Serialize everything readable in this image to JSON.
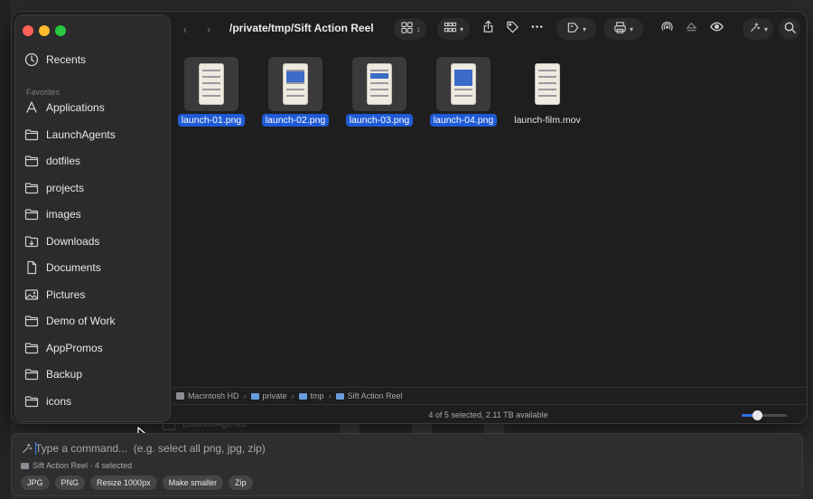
{
  "window": {
    "path_title": "/private/tmp/Sift Action Reel"
  },
  "sidebar": {
    "top_items": [
      {
        "label": "Recents",
        "icon": "clock-icon"
      }
    ],
    "section_label": "Favorites",
    "items": [
      {
        "label": "Applications",
        "icon": "applications-icon"
      },
      {
        "label": "LaunchAgents",
        "icon": "folder-icon"
      },
      {
        "label": "dotfiles",
        "icon": "folder-icon"
      },
      {
        "label": "projects",
        "icon": "folder-icon"
      },
      {
        "label": "images",
        "icon": "folder-icon"
      },
      {
        "label": "Downloads",
        "icon": "download-icon"
      },
      {
        "label": "Documents",
        "icon": "document-icon"
      },
      {
        "label": "Pictures",
        "icon": "picture-icon"
      },
      {
        "label": "Demo of Work",
        "icon": "folder-icon"
      },
      {
        "label": "AppPromos",
        "icon": "folder-icon"
      },
      {
        "label": "Backup",
        "icon": "folder-icon"
      },
      {
        "label": "icons",
        "icon": "folder-icon"
      }
    ]
  },
  "files": [
    {
      "name": "launch-01.png",
      "selected": true
    },
    {
      "name": "launch-02.png",
      "selected": true
    },
    {
      "name": "launch-03.png",
      "selected": true
    },
    {
      "name": "launch-04.png",
      "selected": true
    },
    {
      "name": "launch-film.mov",
      "selected": false
    }
  ],
  "pathbar": {
    "items": [
      "Macintosh HD",
      "private",
      "tmp",
      "Sift Action Reel"
    ]
  },
  "status": {
    "text": "4 of 5 selected, 2.11 TB available",
    "icon_size_level": 0.35
  },
  "background": {
    "ghost_label": "LaunchAgents"
  },
  "command_bar": {
    "placeholder": "Type a command...  (e.g. select all png, jpg, zip)",
    "context": "Sift Action Reel · 4 selected",
    "chips": [
      "JPG",
      "PNG",
      "Resize 1000px",
      "Make smaller",
      "Zip"
    ]
  },
  "colors": {
    "selection": "#1f5bd6",
    "close": "#fe5f57",
    "minimize": "#febc2e",
    "maximize": "#28c840",
    "slider_fill": "#2f6fe8"
  }
}
